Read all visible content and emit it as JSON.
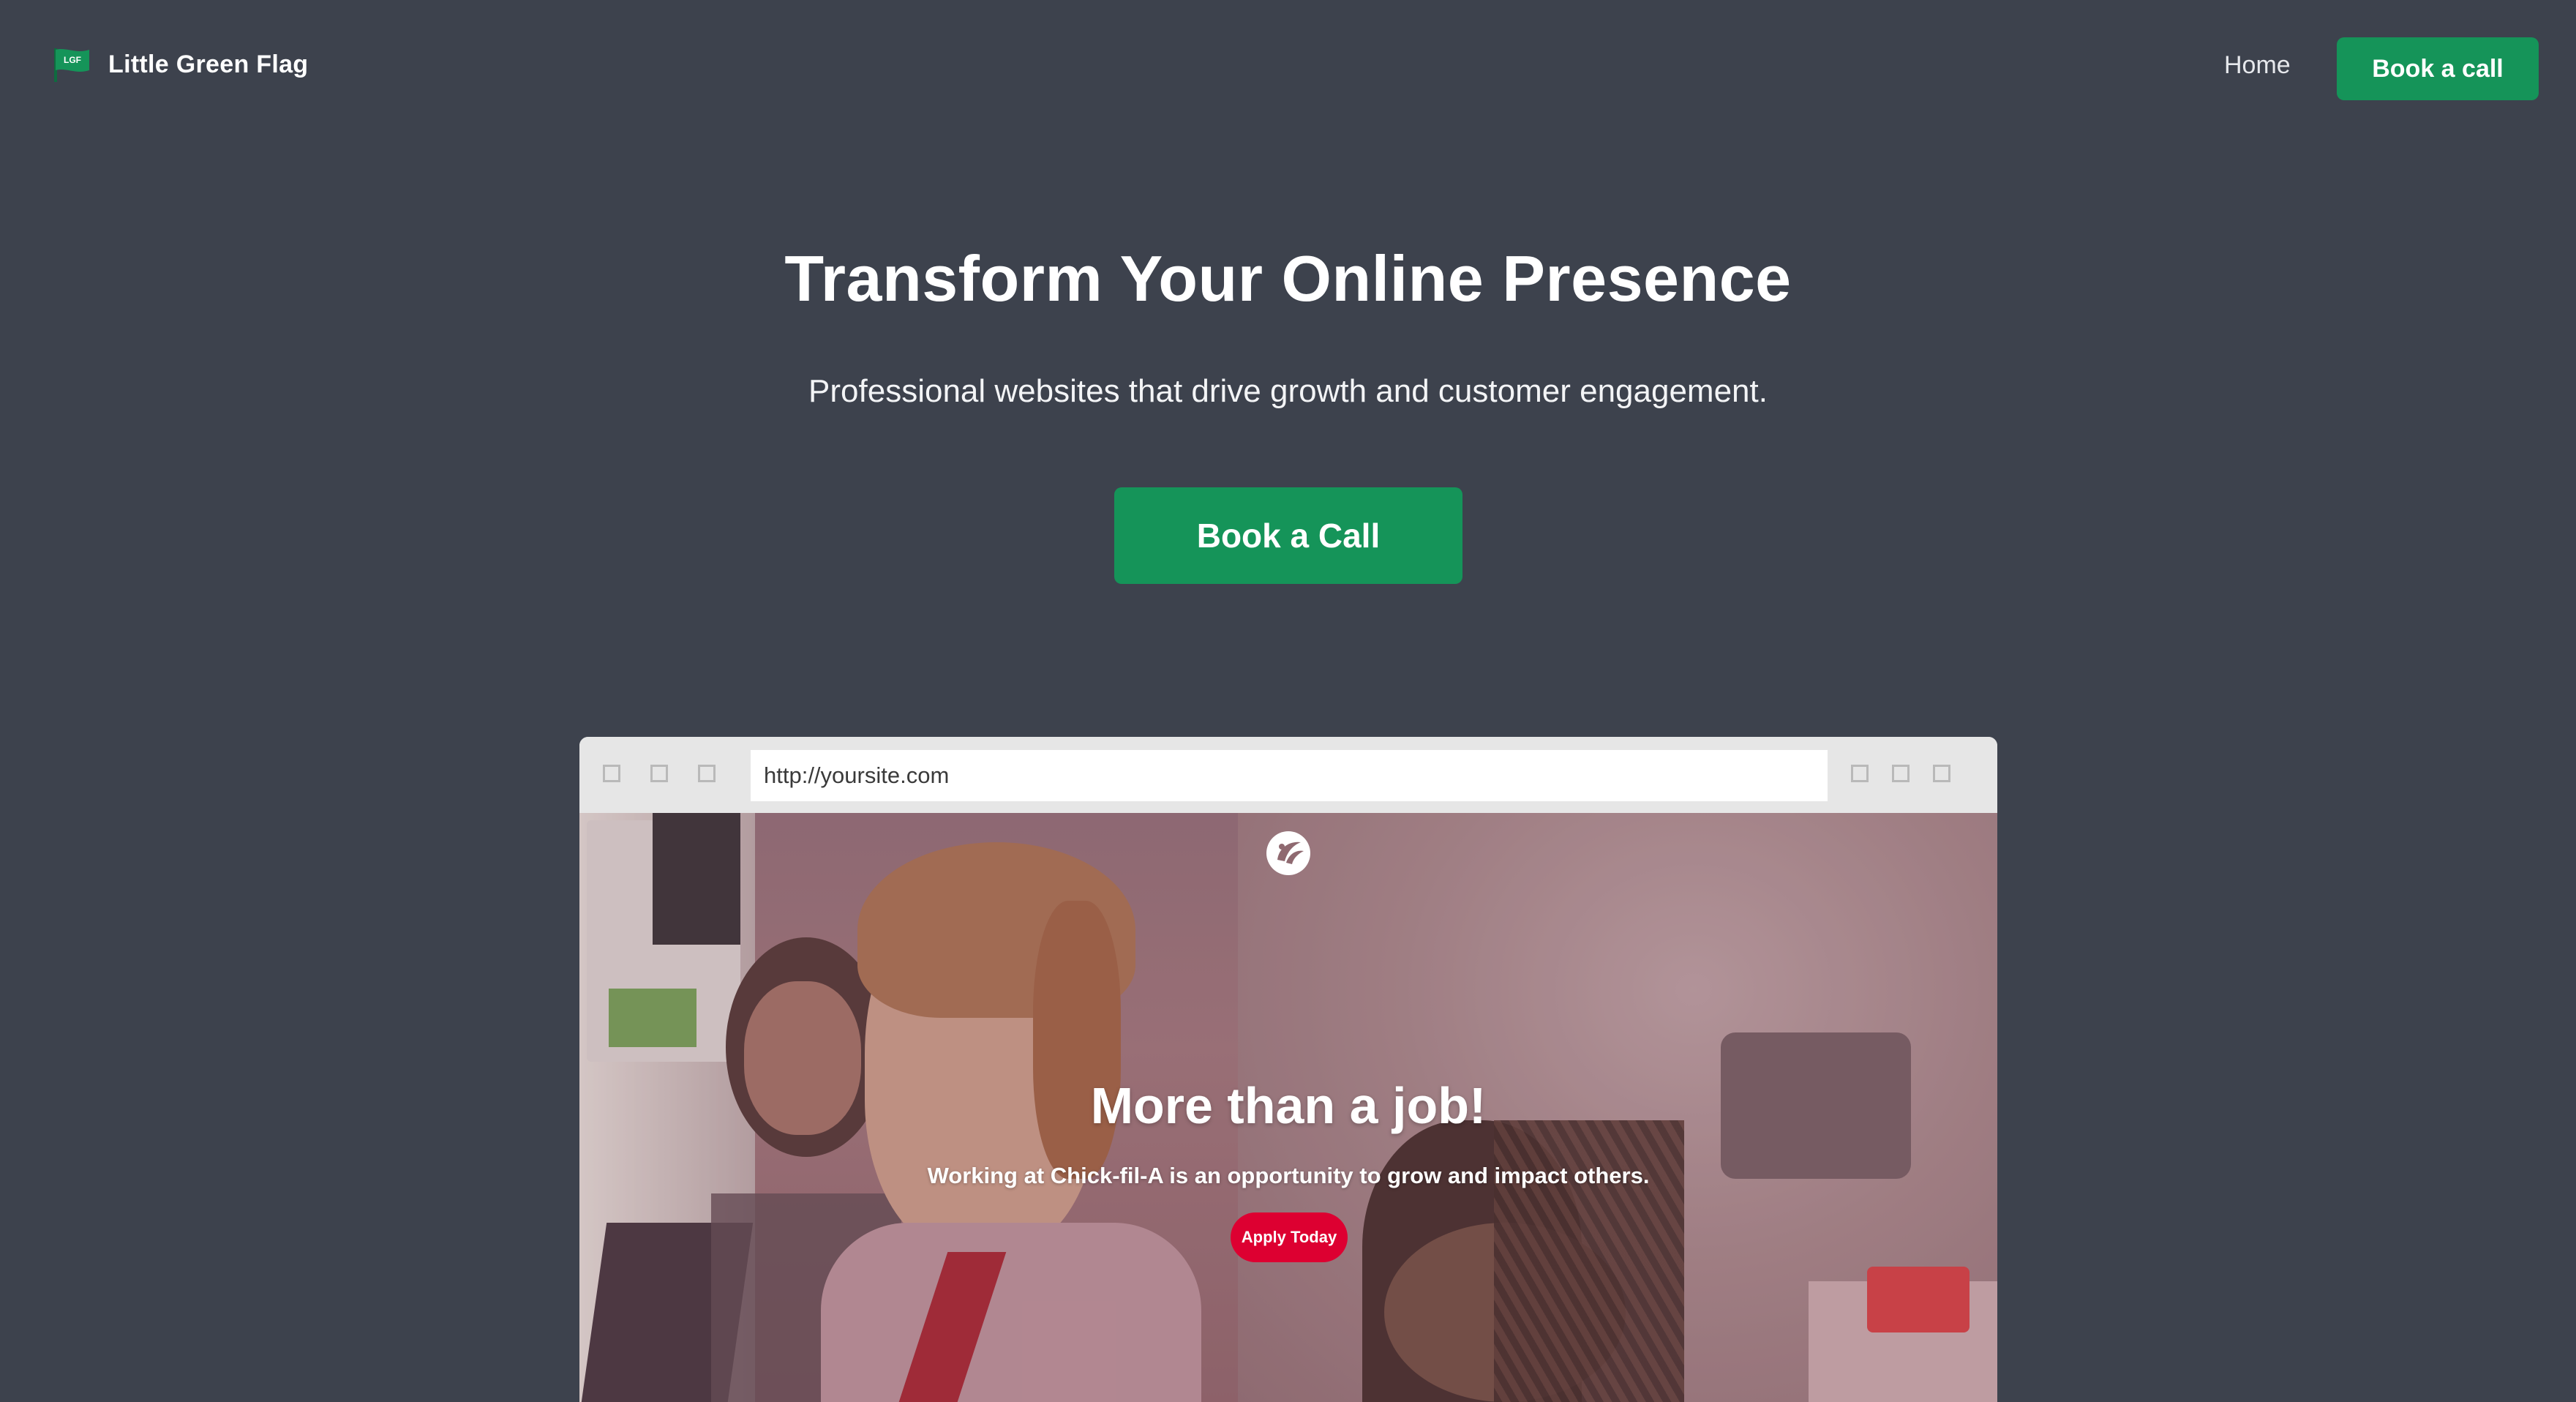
{
  "nav": {
    "brand_badge": "LGF",
    "brand_name": "Little Green Flag",
    "home_label": "Home",
    "cta_label": "Book a call"
  },
  "hero": {
    "title": "Transform Your Online Presence",
    "subtitle": "Professional websites that drive growth and customer engagement.",
    "cta_label": "Book a Call"
  },
  "browser_mock": {
    "url": "http://yoursite.com",
    "site": {
      "title": "More than a job!",
      "subtitle": "Working at Chick-fil-A is an opportunity to grow and impact others.",
      "cta_label": "Apply Today"
    }
  },
  "colors": {
    "page_background": "#3d424d",
    "brand_green": "#159459",
    "site_red": "#dd0031"
  },
  "icons": [
    "flag-logo-icon",
    "window-control-icon",
    "chick-fil-a-logo-icon"
  ]
}
